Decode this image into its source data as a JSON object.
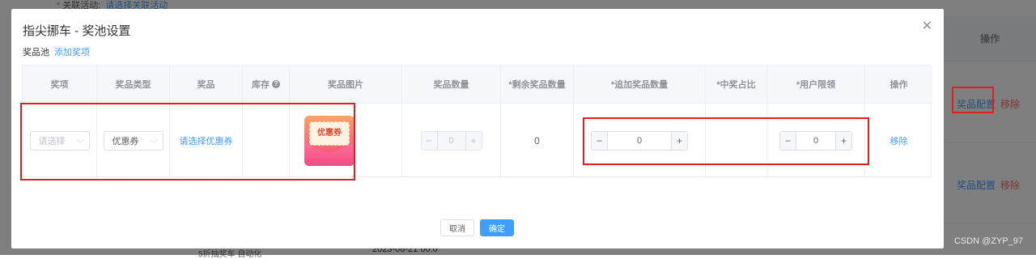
{
  "background": {
    "top_line": {
      "required_mark": "*",
      "label": "关联活动:",
      "link": "请选择关联活动"
    },
    "table": {
      "operation_header": "操作",
      "rows": [
        {
          "config_link": "奖品配置",
          "remove_link": "移除"
        },
        {
          "config_link": "奖品配置",
          "remove_link": "移除"
        }
      ]
    },
    "bottom_text": "5折抽奖车 自动化",
    "bottom_date": "2023-08-21 00:0"
  },
  "dialog": {
    "title": "指尖挪车 - 奖池设置",
    "close_icon": "close-icon",
    "pool_label": "奖品池",
    "add_prize_link": "添加奖项",
    "columns": [
      "奖项",
      "奖品类型",
      "奖品",
      "库存",
      "奖品图片",
      "奖品数量",
      "*剩余奖品数量",
      "*追加奖品数量",
      "*中奖占比",
      "*用户限领",
      "操作"
    ],
    "row": {
      "prize_item": {
        "placeholder": "请选择"
      },
      "prize_type": {
        "value": "优惠券"
      },
      "prize": {
        "link": "请选择优惠券"
      },
      "stock": "",
      "prize_image": {
        "label": "优惠券",
        "icon": "coupon-envelope-icon"
      },
      "prize_quantity": {
        "value": "0",
        "minus": "−",
        "plus": "+"
      },
      "remaining": "0",
      "append_quantity": {
        "value": "0",
        "minus": "−",
        "plus": "+"
      },
      "win_ratio": "",
      "user_limit": {
        "value": "0",
        "minus": "−",
        "plus": "+"
      },
      "operation": "移除"
    },
    "footer": {
      "cancel": "取消",
      "confirm": "确定"
    }
  },
  "watermark": "CSDN @ZYP_97",
  "colors": {
    "primary": "#409eff",
    "danger": "#f56c6c",
    "annotation": "#e02020"
  }
}
